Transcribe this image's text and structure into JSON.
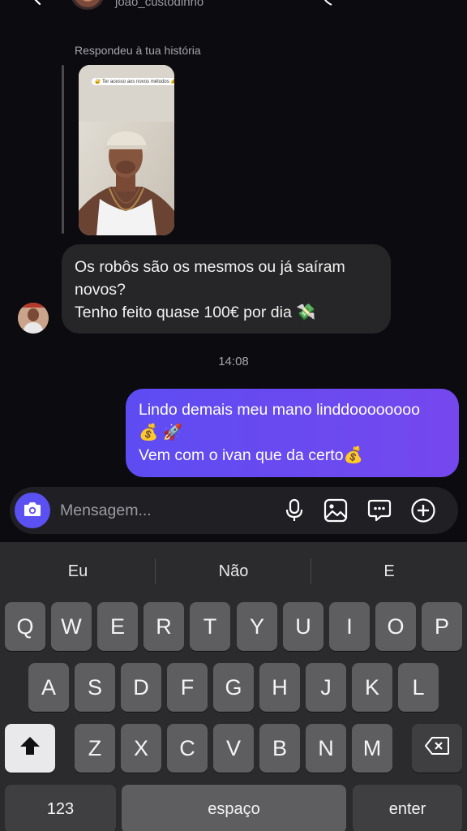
{
  "header": {
    "username": "joao_custodinho"
  },
  "thread": {
    "story_reply_label": "Respondeu à tua história",
    "story_caption": "🔐 Ter acesso aos novos métodos 💰",
    "incoming_message": {
      "line1": "Os robôs são os mesmos ou já saíram",
      "line2": "novos?",
      "line3": "Tenho feito quase 100€ por dia 💸"
    },
    "timestamp": "14:08",
    "outgoing_message": {
      "line1": "Lindo demais meu mano linddoooooooo",
      "line2": "💰 🚀",
      "line3": "Vem com o ivan que da certo💰"
    }
  },
  "composer": {
    "placeholder": "Mensagem..."
  },
  "keyboard": {
    "suggestions": [
      "Eu",
      "Não",
      "E"
    ],
    "row1": [
      "Q",
      "W",
      "E",
      "R",
      "T",
      "Y",
      "U",
      "I",
      "O",
      "P"
    ],
    "row2": [
      "A",
      "S",
      "D",
      "F",
      "G",
      "H",
      "J",
      "K",
      "L"
    ],
    "row3": [
      "Z",
      "X",
      "C",
      "V",
      "B",
      "N",
      "M"
    ],
    "numbers_label": "123",
    "space_label": "espaço",
    "enter_label": "enter"
  },
  "icons": {
    "back": "chevron-left-icon",
    "camera": "camera-icon",
    "mic": "microphone-icon",
    "gallery": "image-icon",
    "sticker": "chat-bubble-icon",
    "more": "plus-circle-icon",
    "shift": "shift-arrow-icon",
    "backspace": "backspace-icon"
  },
  "colors": {
    "background": "#0b0b10",
    "incoming_bubble": "#262629",
    "outgoing_bubble": "#6a4cf0",
    "camera_button": "#5b51f2",
    "keyboard": "#2b2b2d"
  }
}
